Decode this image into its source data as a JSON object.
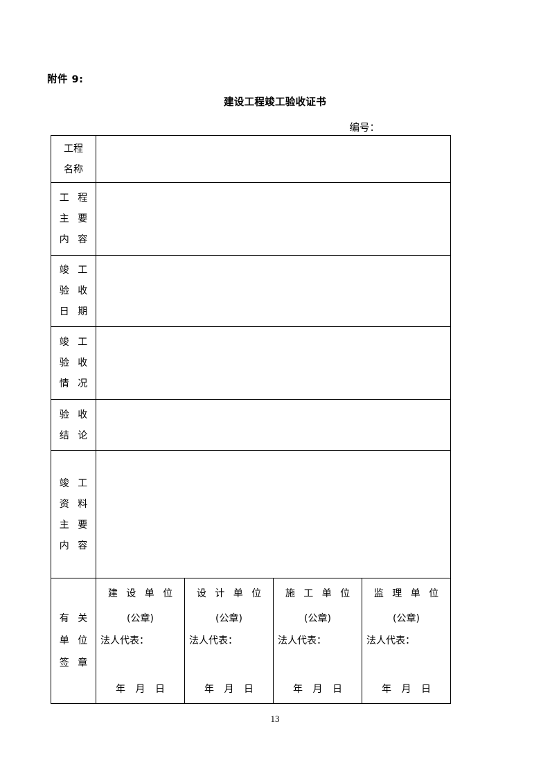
{
  "document": {
    "attachment_label": "附件 9:",
    "title": "建设工程竣工验收证书",
    "serial_label": "编号：",
    "page_number": "13"
  },
  "table": {
    "rows": [
      {
        "label_lines": [
          "工程",
          "名称"
        ],
        "spaced": false,
        "value": ""
      },
      {
        "label_lines": [
          "工 程",
          "主 要",
          "内 容"
        ],
        "spaced": true,
        "value": ""
      },
      {
        "label_lines": [
          "竣 工",
          "验 收",
          "日 期"
        ],
        "spaced": true,
        "value": ""
      },
      {
        "label_lines": [
          "竣 工",
          "验 收",
          "情 况"
        ],
        "spaced": true,
        "value": ""
      },
      {
        "label_lines": [
          "验 收",
          "结 论"
        ],
        "spaced": true,
        "value": ""
      },
      {
        "label_lines": [
          "竣 工",
          "资 料",
          "主 要",
          "内 容"
        ],
        "spaced": true,
        "value": ""
      }
    ],
    "signature_row": {
      "label_lines": [
        "有 关",
        "单 位",
        "签 章"
      ],
      "columns": [
        {
          "organization": "建 设 单 位",
          "seal": "(公章)",
          "representative": "法人代表：",
          "representative_value": "",
          "date": "年  月  日"
        },
        {
          "organization": "设 计 单 位",
          "seal": "(公章)",
          "representative": "法人代表：",
          "representative_value": "",
          "date": "年  月  日"
        },
        {
          "organization": "施 工 单 位",
          "seal": "(公章)",
          "representative": "法人代表：",
          "representative_value": "",
          "date": "年  月  日"
        },
        {
          "organization": "监 理 单 位",
          "seal": "(公章)",
          "representative": "法人代表：",
          "representative_value": "",
          "date": "年  月  日"
        }
      ]
    }
  }
}
